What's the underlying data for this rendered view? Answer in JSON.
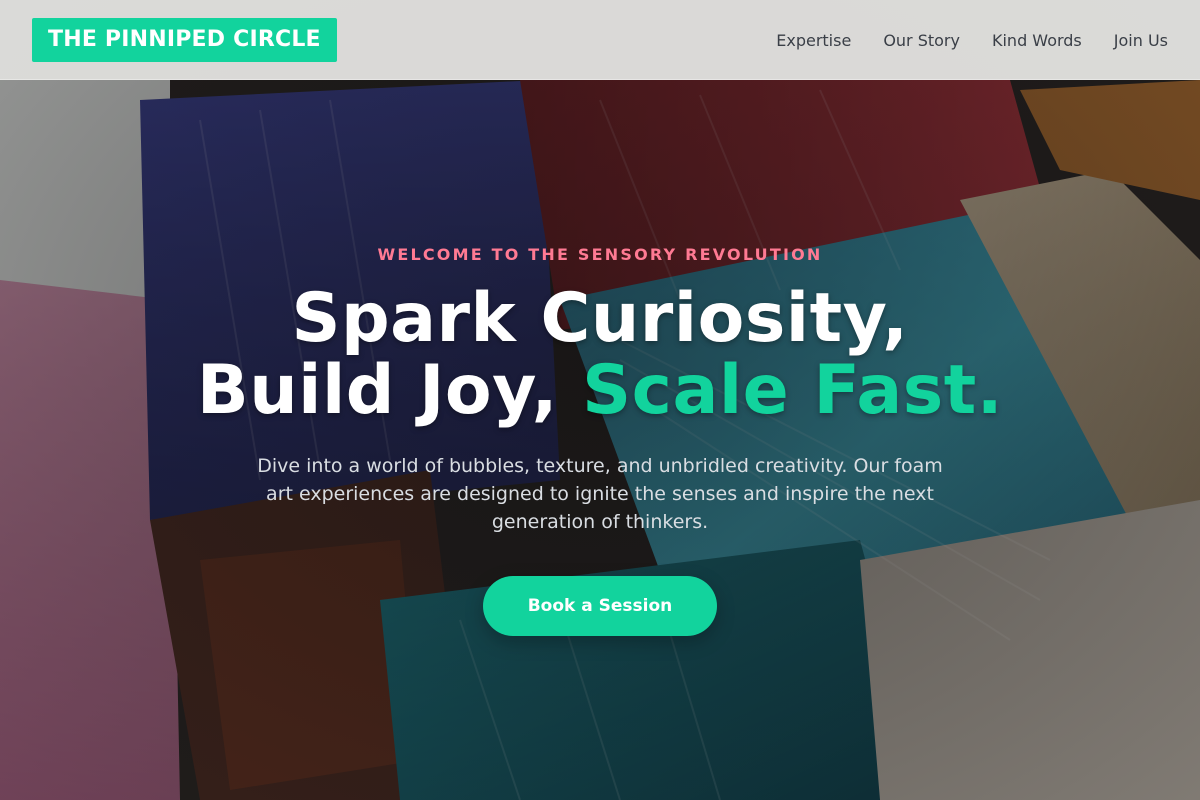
{
  "brand": {
    "name": "THE PINNIPED CIRCLE"
  },
  "nav": {
    "links": [
      "Expertise",
      "Our Story",
      "Kind Words",
      "Join Us"
    ]
  },
  "hero": {
    "eyebrow": "WELCOME TO THE SENSORY REVOLUTION",
    "headline_line1": "Spark Curiosity,",
    "headline_line2_plain": "Build Joy, ",
    "headline_line2_accent": "Scale Fast.",
    "lead": "Dive into a world of bubbles, texture, and unbridled creativity. Our foam art experiences are designed to ignite the senses and inspire the next generation of thinkers.",
    "cta_label": "Book a Session"
  },
  "colors": {
    "accent": "#12d39d",
    "eyebrow": "#ff7a93",
    "nav_text": "#3a3f47",
    "headline": "#ffffff",
    "lead": "#d9dde2"
  }
}
